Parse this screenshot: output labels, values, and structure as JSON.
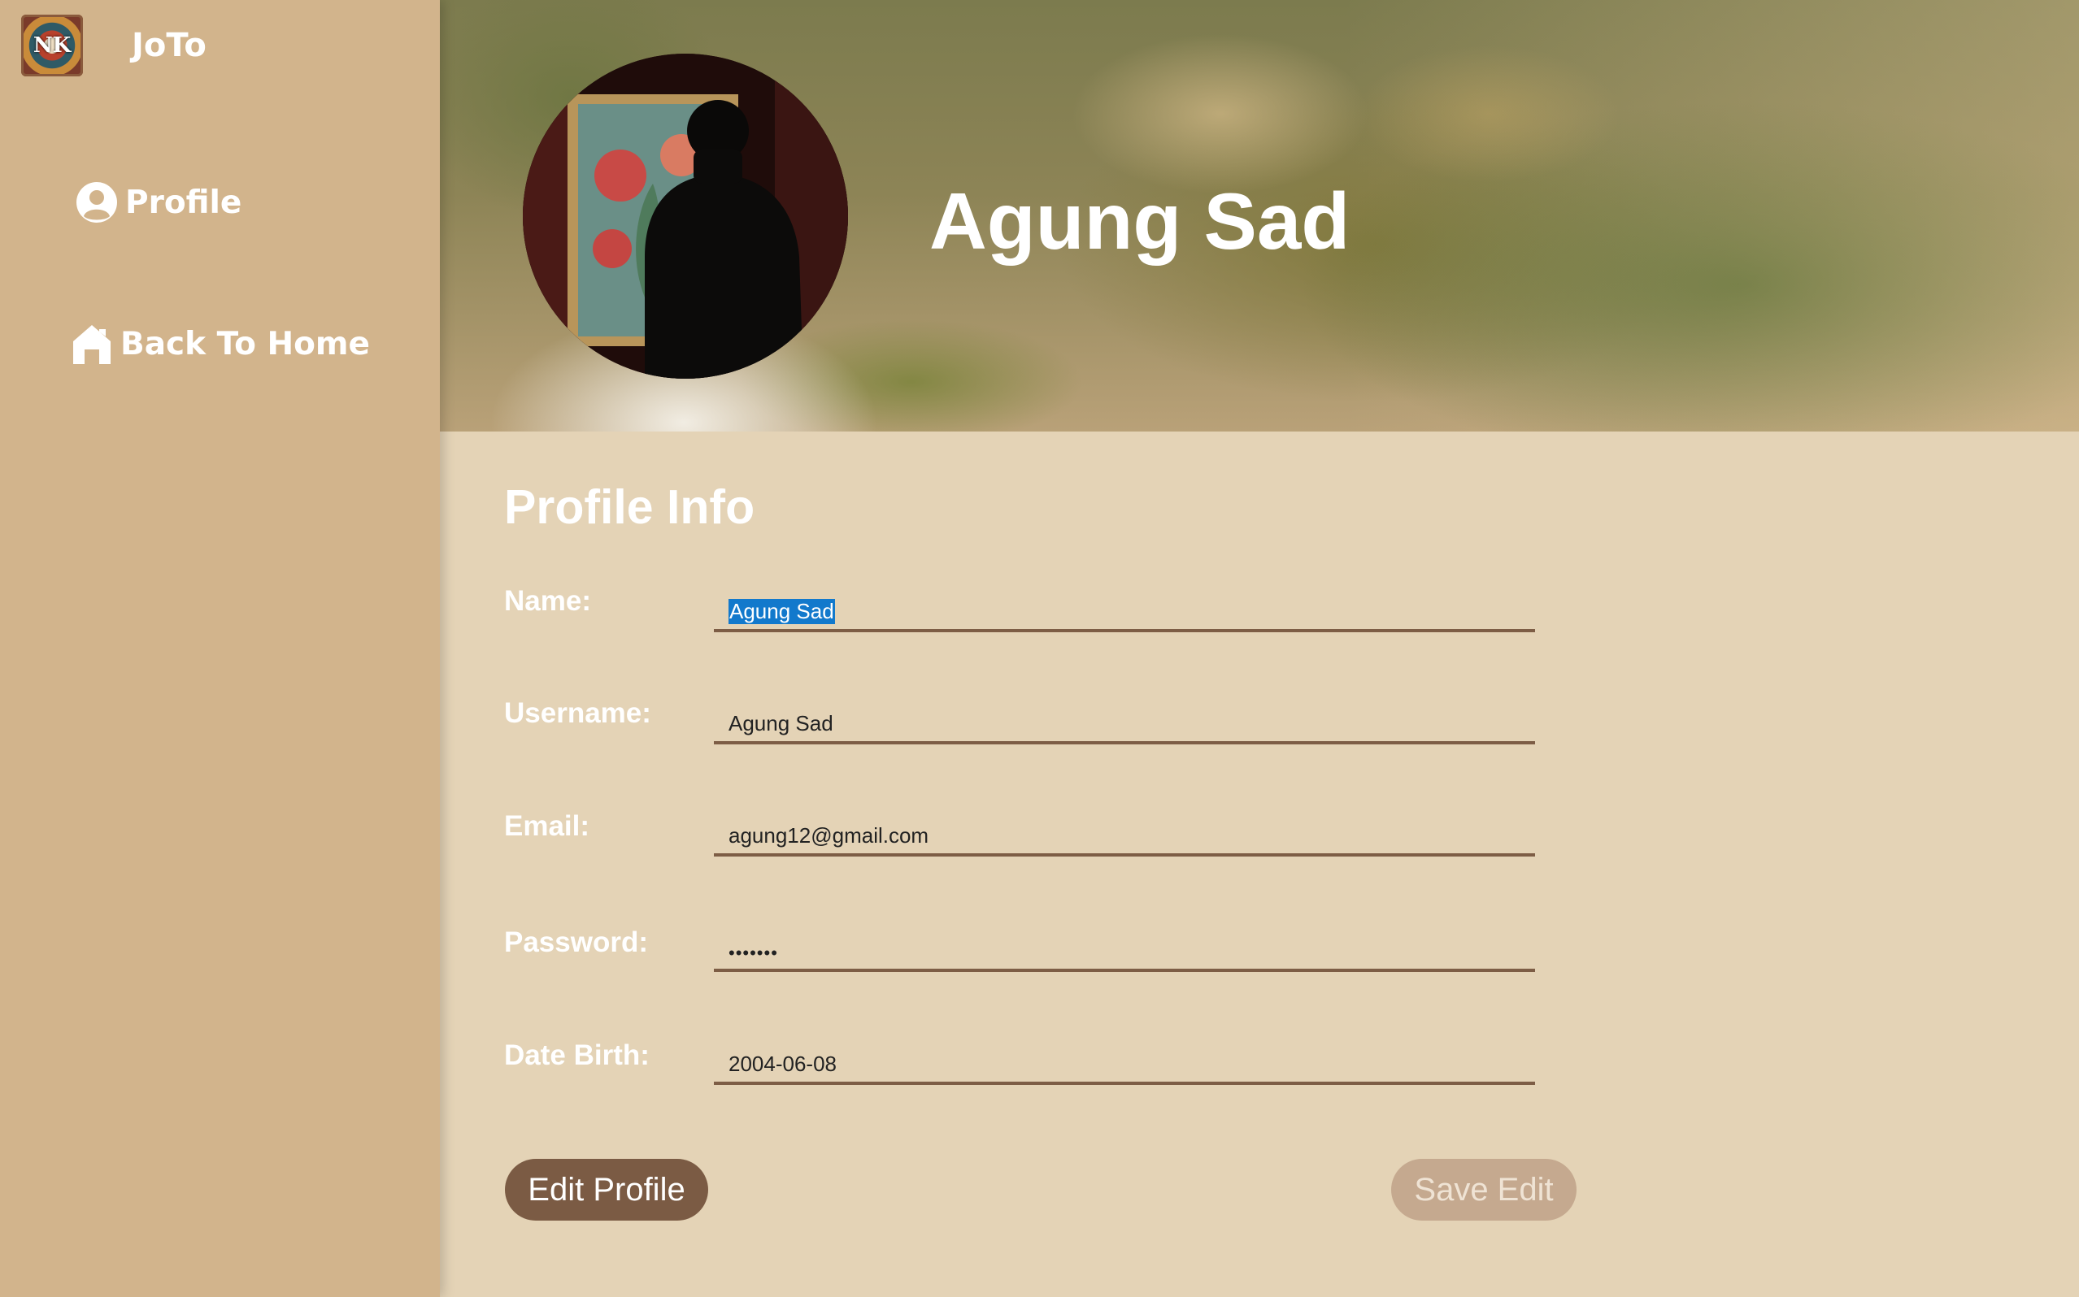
{
  "app": {
    "title": "JoTo",
    "logo_text": "NK"
  },
  "sidebar": {
    "items": [
      {
        "label": "Profile",
        "icon": "user-circle-icon"
      },
      {
        "label": "Back To Home",
        "icon": "home-icon"
      }
    ]
  },
  "hero": {
    "display_name": "Agung Sad"
  },
  "profile_info": {
    "title": "Profile Info",
    "fields": {
      "name": {
        "label": "Name:",
        "value": "Agung Sad"
      },
      "username": {
        "label": "Username:",
        "value": "Agung Sad"
      },
      "email": {
        "label": "Email:",
        "value": "agung12@gmail.com"
      },
      "password": {
        "label": "Password:",
        "value": "•••••••"
      },
      "date_birth": {
        "label": "Date Birth:",
        "value": "2004-06-08"
      }
    }
  },
  "actions": {
    "edit_label": "Edit Profile",
    "save_label": "Save Edit"
  },
  "colors": {
    "sidebar": "#d2b48c",
    "content_bg": "#e4d3b6",
    "accent": "#7b5b44",
    "disabled_button": "#c5a98f",
    "selection": "#1279cc"
  }
}
